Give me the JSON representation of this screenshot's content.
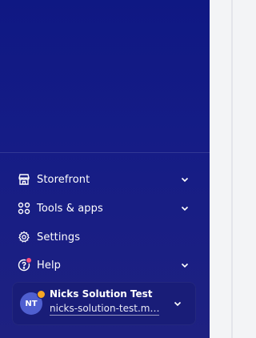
{
  "nav": {
    "items": [
      {
        "label": "Storefront",
        "icon": "storefront-icon",
        "has_chevron": true
      },
      {
        "label": "Tools & apps",
        "icon": "apps-grid-icon",
        "has_chevron": true
      },
      {
        "label": "Settings",
        "icon": "gear-icon",
        "has_chevron": false
      },
      {
        "label": "Help",
        "icon": "help-circle-icon",
        "has_chevron": true,
        "badge_color": "#ff4d7e"
      }
    ]
  },
  "account": {
    "initials": "NT",
    "name": "Nicks Solution Test",
    "url": "nicks-solution-test.m…",
    "status_color": "#f6a623"
  },
  "colors": {
    "sidebar_bg": "#151c86",
    "text": "#ffffff",
    "avatar_bg": "#4f5fd0"
  }
}
